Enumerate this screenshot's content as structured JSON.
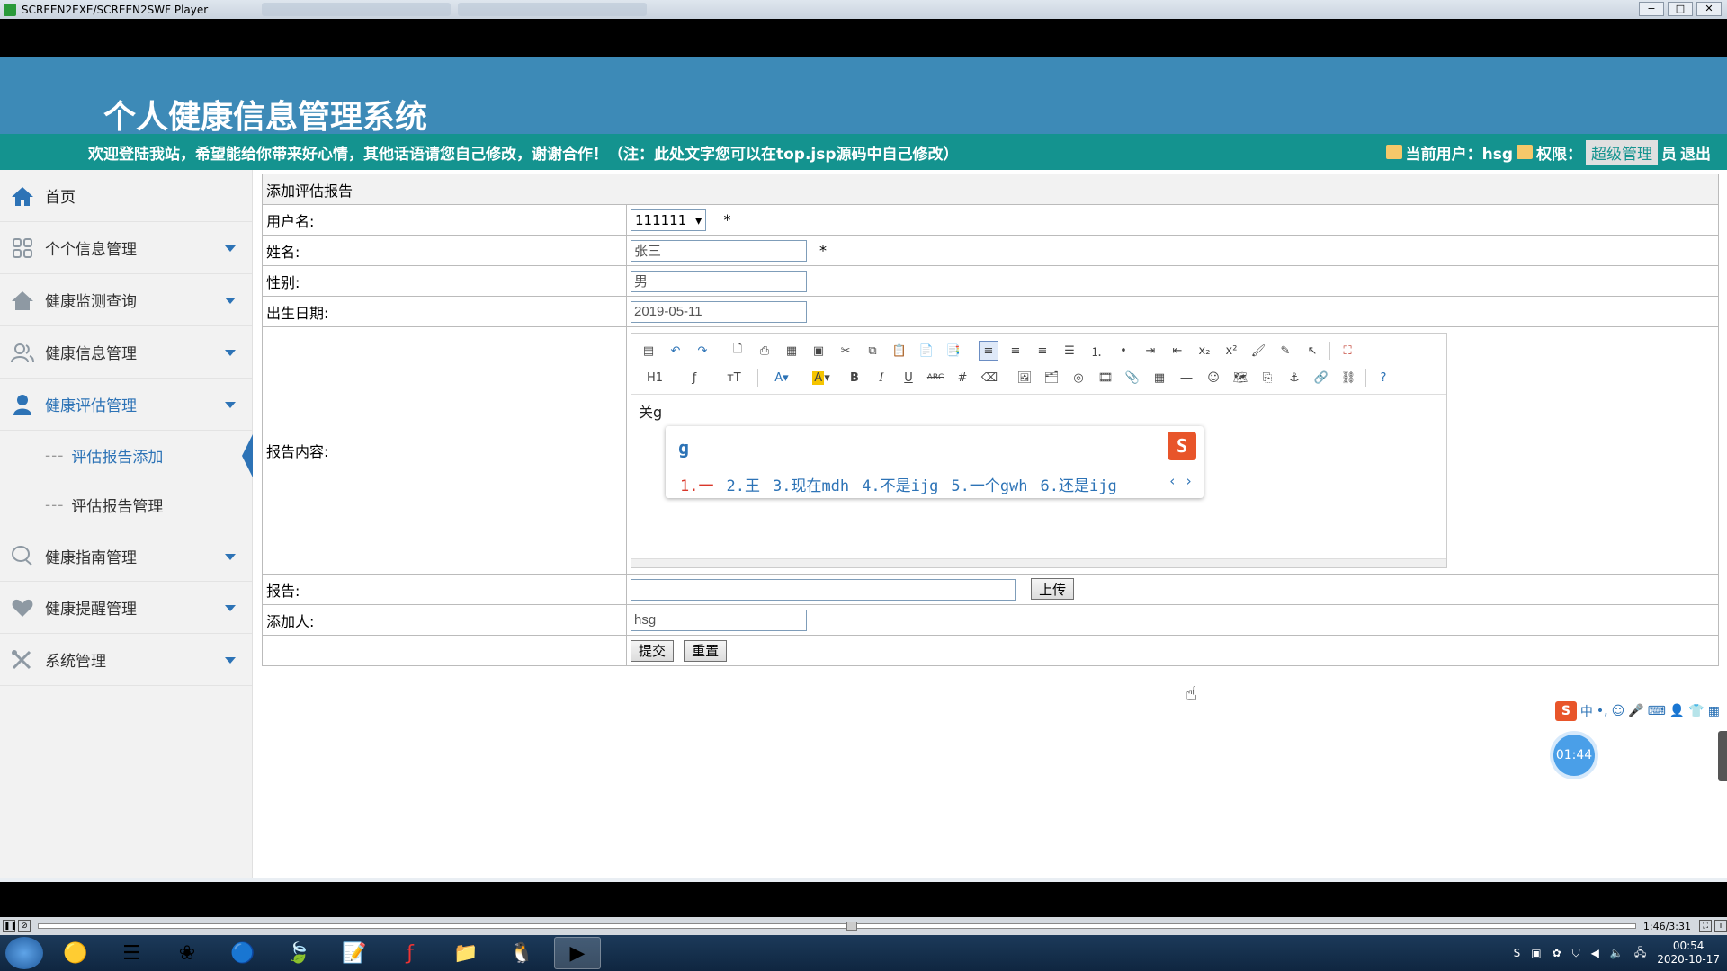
{
  "player": {
    "title": "SCREEN2EXE/SCREEN2SWF Player",
    "controls": [
      "−",
      "□",
      "✕"
    ],
    "time": "1:46/3:31"
  },
  "header": {
    "system_title": "个人健康信息管理系统",
    "welcome": "欢迎登陆我站，希望能给你带来好心情，其他话语请您自己修改，谢谢合作！（注：此处文字您可以在top.jsp源码中自己修改）",
    "current_user_label": "当前用户：hsg",
    "role_label": "权限：",
    "role_value": "超级管理",
    "role_suffix": "员",
    "logout": "退出"
  },
  "sidebar": {
    "home": "首页",
    "items": [
      {
        "label": "个个信息管理",
        "icon": "grid-icon"
      },
      {
        "label": "健康监测查询",
        "icon": "house-icon"
      },
      {
        "label": "健康信息管理",
        "icon": "users-icon"
      },
      {
        "label": "健康评估管理",
        "icon": "user-icon"
      }
    ],
    "sub_items": [
      {
        "label": "评估报告添加"
      },
      {
        "label": "评估报告管理"
      }
    ],
    "items_after": [
      {
        "label": "健康指南管理",
        "icon": "chat-icon"
      },
      {
        "label": "健康提醒管理",
        "icon": "heart-icon"
      },
      {
        "label": "系统管理",
        "icon": "tools-icon"
      }
    ]
  },
  "form": {
    "title": "添加评估报告",
    "username_label": "用户名:",
    "username_value": "111111",
    "required_mark": "*",
    "name_label": "姓名:",
    "name_value": "张三",
    "gender_label": "性别:",
    "gender_value": "男",
    "birth_label": "出生日期:",
    "birth_value": "2019-05-11",
    "content_label": "报告内容:",
    "content_text": "关g",
    "report_label": "报告:",
    "report_value": "",
    "upload_button": "上传",
    "adder_label": "添加人:",
    "adder_value": "hsg",
    "submit_button": "提交",
    "reset_button": "重置"
  },
  "toolbar": {
    "h1": "H1",
    "font": "ƒ",
    "size": "тT",
    "bold": "B",
    "italic": "I",
    "underline": "U",
    "strike": "ABC"
  },
  "ime": {
    "pinyin": "g",
    "candidates": [
      "1.一",
      "2.王",
      "3.现在mdh",
      "4.不是ijg",
      "5.一个gwh",
      "6.还是ijg"
    ],
    "timer": "01:44"
  },
  "taskbar": {
    "time": "00:54",
    "date": "2020-10-17"
  }
}
